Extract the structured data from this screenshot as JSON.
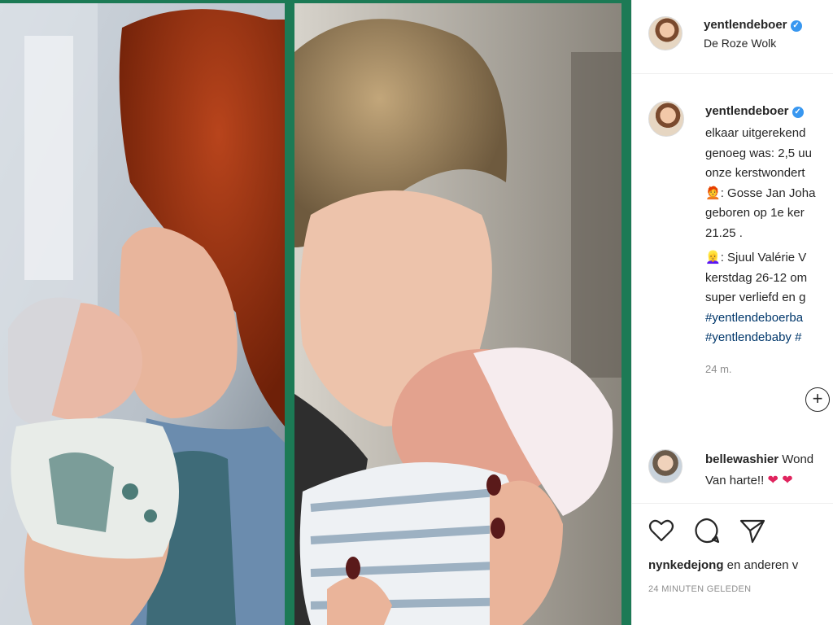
{
  "post": {
    "username": "yentlendeboer",
    "location": "De Roze Wolk",
    "caption_lines": [
      "elkaar uitgerekend",
      "genoeg was: 2,5 uu",
      "onze kerstwondert",
      ": Gosse Jan Joha",
      "geboren op 1e ker",
      "21.25 .",
      ": Sjuul Valérie V",
      "kerstdag 26-12 om",
      "super verliefd en g"
    ],
    "hashtags": [
      "#yentlendeboerba",
      "#yentlendebaby #"
    ],
    "time_ago": "24 m."
  },
  "comment": {
    "username": "bellewashier",
    "text_start": "Wond",
    "line2": "Van harte!!",
    "hearts": "❤ ❤"
  },
  "likes": {
    "user": "nynkedejong",
    "rest": " en anderen v"
  },
  "posted": "24 MINUTEN GELEDEN",
  "icons": [
    "heart-icon",
    "comment-icon",
    "share-icon",
    "add-icon",
    "verified-icon"
  ],
  "colors": {
    "frame": "#1c7a55",
    "link": "#00376b",
    "muted": "#8e8e8e",
    "verified": "#3897f0",
    "heart": "#e0245e"
  }
}
